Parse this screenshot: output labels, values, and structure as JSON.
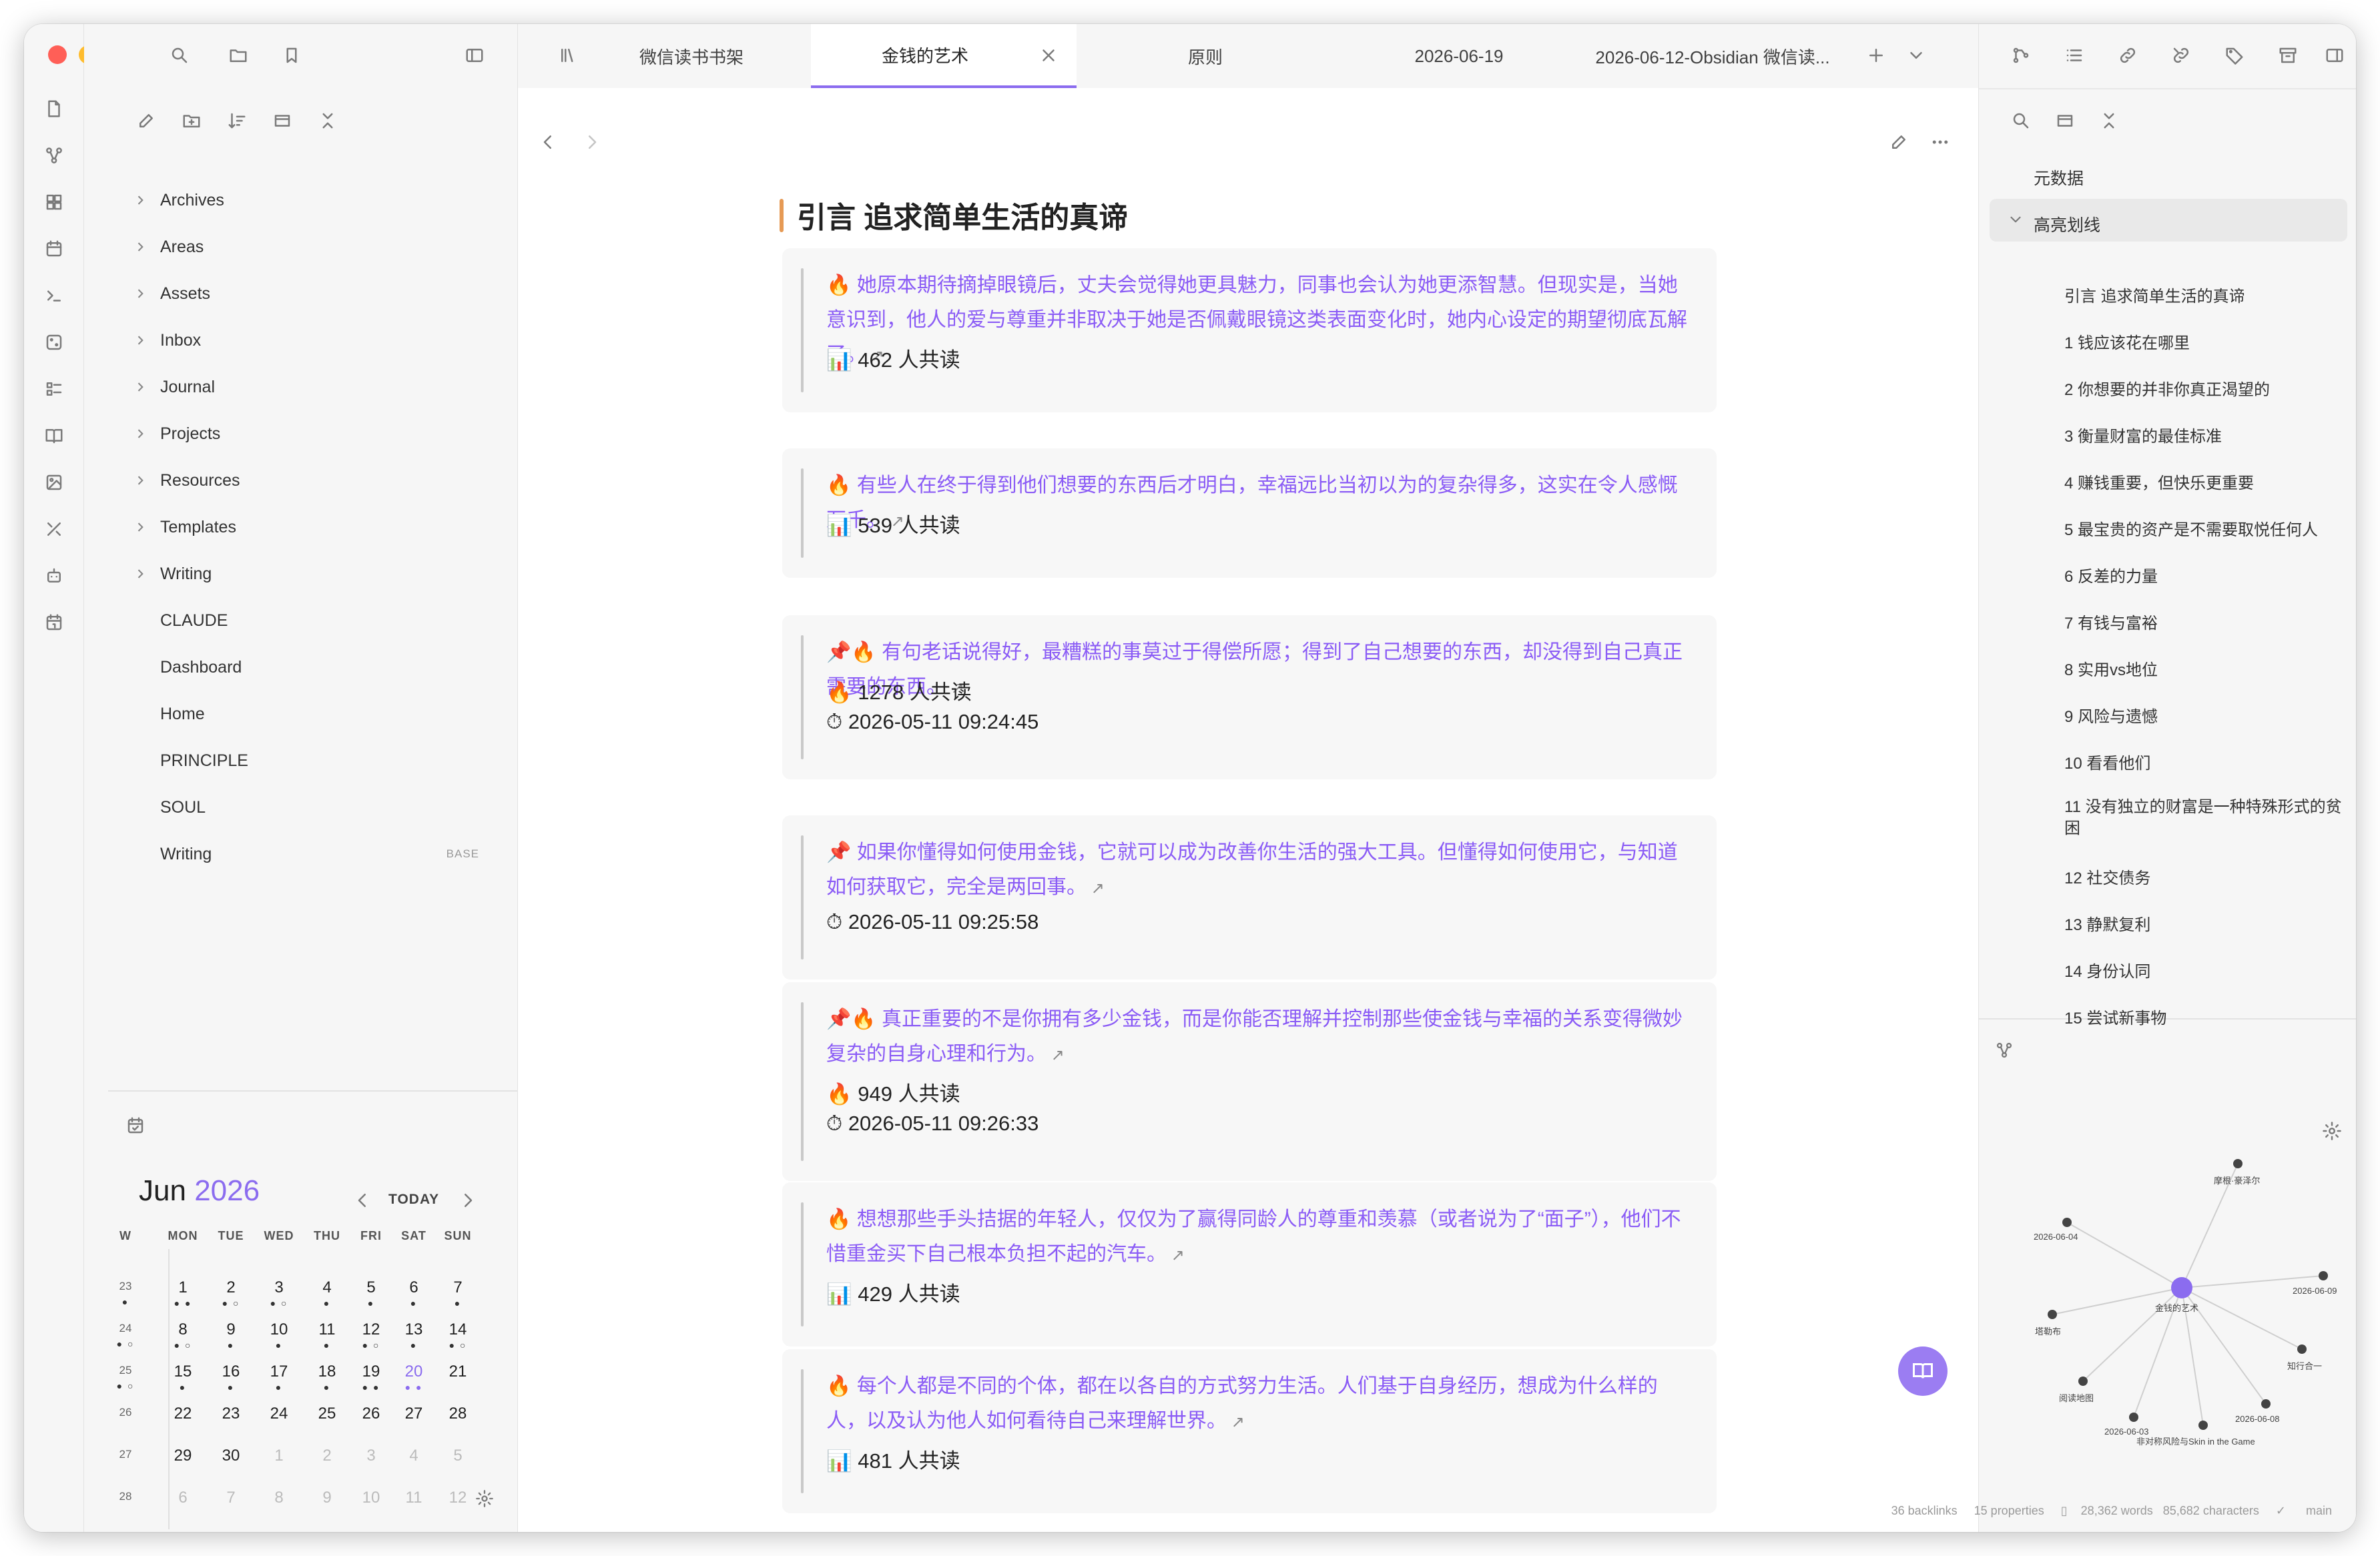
{
  "tabs": [
    {
      "label": "微信读书书架"
    },
    {
      "label": "金钱的艺术"
    },
    {
      "label": "原则"
    },
    {
      "label": "2026-06-19"
    },
    {
      "label": "2026-06-12-Obsidian 微信读..."
    }
  ],
  "explorer": {
    "folders": [
      "Archives",
      "Areas",
      "Assets",
      "Inbox",
      "Journal",
      "Projects",
      "Resources",
      "Templates",
      "Writing"
    ],
    "files": [
      "CLAUDE",
      "Dashboard",
      "Home",
      "PRINCIPLE",
      "SOUL",
      "Writing"
    ],
    "badge": "BASE"
  },
  "calendar": {
    "month": "Jun",
    "year": "2026",
    "today_label": "TODAY",
    "headers": [
      "W",
      "MON",
      "TUE",
      "WED",
      "THU",
      "FRI",
      "SAT",
      "SUN"
    ],
    "weeks": [
      {
        "w": "23",
        "days": [
          "1",
          "2",
          "3",
          "4",
          "5",
          "6",
          "7"
        ]
      },
      {
        "w": "24",
        "days": [
          "8",
          "9",
          "10",
          "11",
          "12",
          "13",
          "14"
        ]
      },
      {
        "w": "25",
        "days": [
          "15",
          "16",
          "17",
          "18",
          "19",
          "20",
          "21"
        ]
      },
      {
        "w": "26",
        "days": [
          "22",
          "23",
          "24",
          "25",
          "26",
          "27",
          "28"
        ]
      },
      {
        "w": "27",
        "days": [
          "29",
          "30",
          "1",
          "2",
          "3",
          "4",
          "5"
        ]
      },
      {
        "w": "28",
        "days": [
          "6",
          "7",
          "8",
          "9",
          "10",
          "11",
          "12"
        ]
      }
    ]
  },
  "note": {
    "heading": "引言 追求简单生活的真谛",
    "cards": [
      {
        "icon": "🔥",
        "text": "她原本期待摘掉眼镜后，丈夫会觉得她更具魅力，同事也会认为她更添智慧。但现实是，当她意识到，他人的爱与尊重并非取决于她是否佩戴眼镜这类表面变化时，她内心设定的期望彻底瓦解了。",
        "meta": [
          {
            "icon": "📊",
            "text": "462 人共读"
          }
        ]
      },
      {
        "icon": "🔥",
        "text": "有些人在终于得到他们想要的东西后才明白，幸福远比当初以为的复杂得多，这实在令人感慨万千。",
        "meta": [
          {
            "icon": "📊",
            "text": "539 人共读"
          }
        ]
      },
      {
        "icon": "📌🔥",
        "text": "有句老话说得好，最糟糕的事莫过于得偿所愿；得到了自己想要的东西，却没得到自己真正需要的东西。",
        "meta": [
          {
            "icon": "🔥",
            "text": "1278 人共读"
          },
          {
            "icon": "⏱",
            "text": "2026-05-11 09:24:45"
          }
        ]
      },
      {
        "icon": "📌",
        "text": "如果你懂得如何使用金钱，它就可以成为改善你生活的强大工具。但懂得如何使用它，与知道如何获取它，完全是两回事。",
        "meta": [
          {
            "icon": "⏱",
            "text": "2026-05-11 09:25:58"
          }
        ]
      },
      {
        "icon": "📌🔥",
        "text": "真正重要的不是你拥有多少金钱，而是你能否理解并控制那些使金钱与幸福的关系变得微妙复杂的自身心理和行为。",
        "meta": [
          {
            "icon": "🔥",
            "text": "949 人共读"
          },
          {
            "icon": "⏱",
            "text": "2026-05-11 09:26:33"
          }
        ]
      },
      {
        "icon": "🔥",
        "text": "想想那些手头拮据的年轻人，仅仅为了赢得同龄人的尊重和羡慕（或者说为了“面子”），他们不惜重金买下自己根本负担不起的汽车。",
        "meta": [
          {
            "icon": "📊",
            "text": "429 人共读"
          }
        ]
      },
      {
        "icon": "🔥",
        "text": "每个人都是不同的个体，都在以各自的方式努力生活。人们基于自身经历，想成为什么样的人，以及认为他人如何看待自己来理解世界。",
        "meta": [
          {
            "icon": "📊",
            "text": "481 人共读"
          }
        ]
      }
    ]
  },
  "outline": {
    "metadata": "元数据",
    "section": "高亮划线",
    "items": [
      "引言 追求简单生活的真谛",
      "1 钱应该花在哪里",
      "2 你想要的并非你真正渴望的",
      "3 衡量财富的最佳标准",
      "4 赚钱重要，但快乐更重要",
      "5 最宝贵的资产是不需要取悦任何人",
      "6 反差的力量",
      "7 有钱与富裕",
      "8 实用vs地位",
      "9 风险与遗憾",
      "10 看看他们",
      "11 没有独立的财富是一种特殊形式的贫困",
      "12 社交债务",
      "13 静默复利",
      "14 身份认同",
      "15 尝试新事物"
    ]
  },
  "graph": {
    "center": "金钱的艺术",
    "nodes": [
      "摩根·豪泽尔",
      "2026-06-04",
      "2026-06-09",
      "塔勒布",
      "知行合一",
      "阅读地图",
      "2026-06-08",
      "2026-06-03",
      "非对称风险与Skin in the Game"
    ]
  },
  "status": {
    "backlinks": "36 backlinks",
    "properties": "15 properties",
    "words": "28,362 words",
    "characters": "85,682 characters",
    "branch": "main"
  },
  "colors": {
    "accent": "#8b6cef",
    "highlight_text": "#8b5cf6",
    "heading_bar": "#e69a55"
  }
}
